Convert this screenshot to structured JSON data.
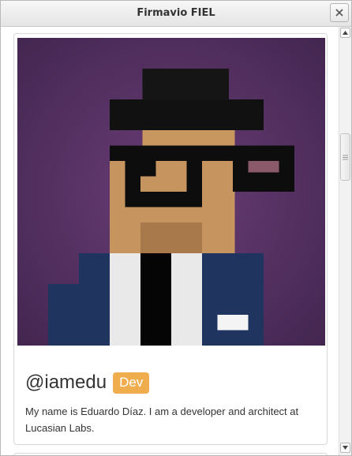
{
  "window": {
    "title": "Firmavio FIEL",
    "close_icon": "close-icon"
  },
  "profile": {
    "avatar_icon": "pixel-avatar",
    "handle": "@iamedu",
    "badge": "Dev",
    "bio": "My name is Eduardo Díaz. I am a developer and architect at Lucasian Labs."
  },
  "colors": {
    "badge": "#f0ad4e",
    "avatar_bg": "#5b3466",
    "hat": "#121212",
    "skin": "#c6955f",
    "jacket": "#1f3560"
  }
}
